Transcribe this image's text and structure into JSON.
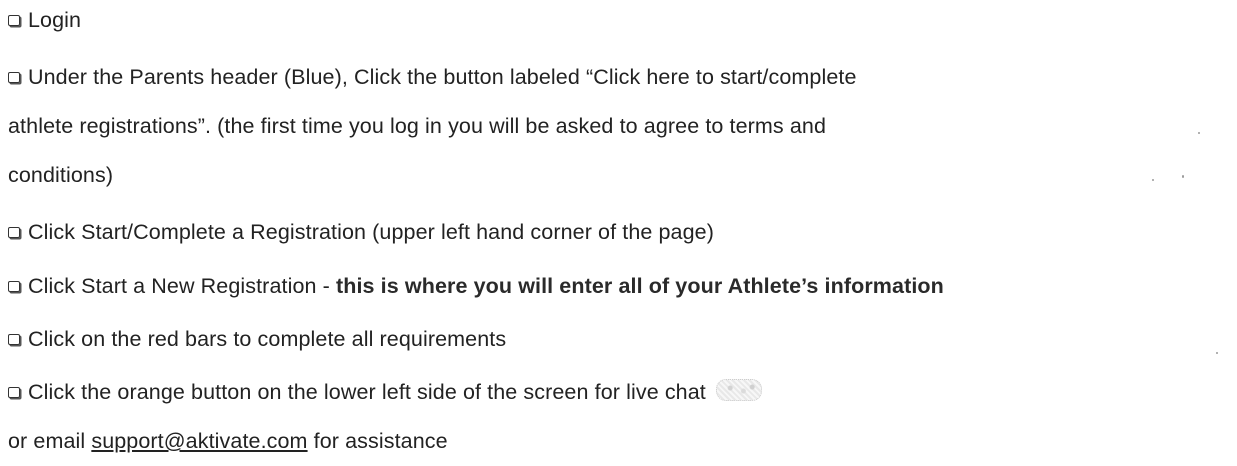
{
  "steps": [
    {
      "text": "Login"
    },
    {
      "text_line1": "Under the Parents header (Blue), Click the button labeled “Click here to start/complete",
      "text_line2": "athlete registrations”. (the first time you log in you will be asked to agree to terms and",
      "text_line3": "conditions)"
    },
    {
      "text": "Click Start/Complete a Registration (upper left hand corner of the page)"
    },
    {
      "text_prefix": "Click Start a New Registration - ",
      "text_bold": "this is where you will enter all of your Athlete’s information"
    },
    {
      "text": "Click on the red bars to complete all requirements"
    },
    {
      "text": "Click the orange button on the lower left side of the screen for live chat"
    }
  ],
  "footer": {
    "prefix": "or email ",
    "email": "support@aktivate.com",
    "suffix": " for assistance"
  },
  "icons": {
    "checkbox": "checkbox-icon",
    "chat": "live-chat-icon"
  }
}
